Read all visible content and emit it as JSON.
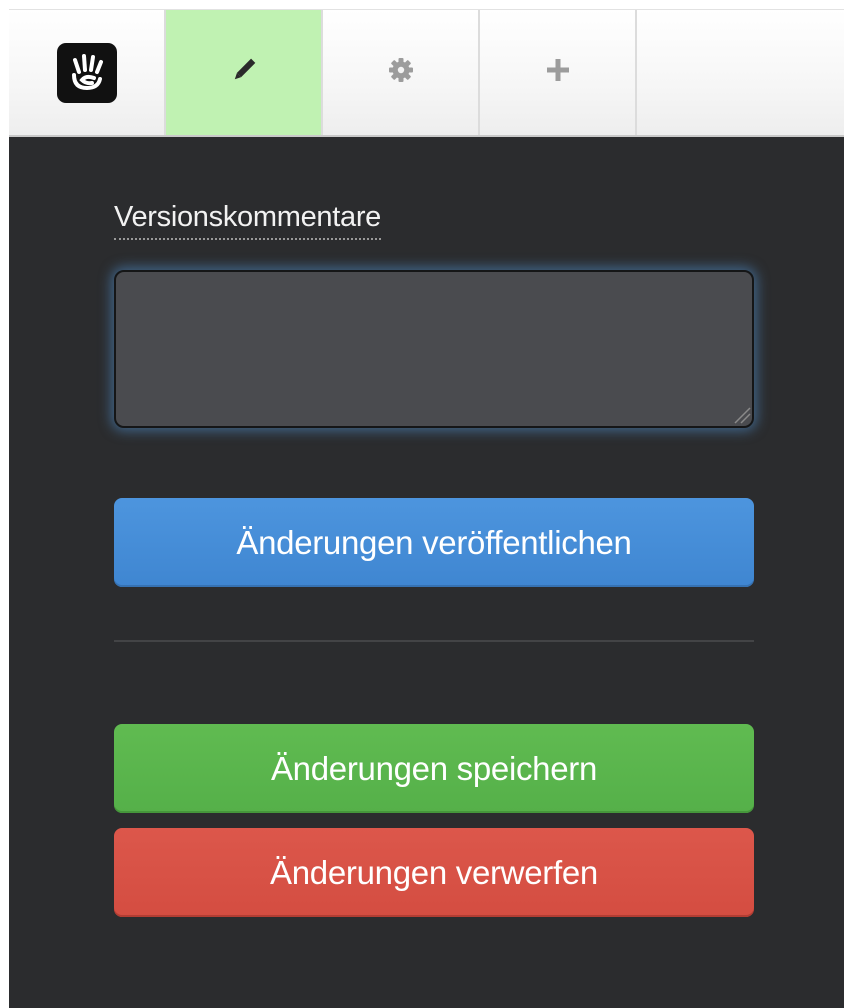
{
  "toolbar": {
    "items": [
      {
        "name": "logo",
        "icon": "hand-logo-icon",
        "active": false
      },
      {
        "name": "edit",
        "icon": "pencil-icon",
        "active": true
      },
      {
        "name": "settings",
        "icon": "gear-icon",
        "active": false
      },
      {
        "name": "add",
        "icon": "plus-icon",
        "active": false
      }
    ]
  },
  "panel": {
    "comment_label": "Versionskommentare",
    "comment_value": "",
    "publish_label": "Änderungen veröffentlichen",
    "save_label": "Änderungen speichern",
    "discard_label": "Änderungen verwerfen"
  },
  "colors": {
    "toolbar_active": "#c0f2b2",
    "panel_background": "#2b2c2e",
    "publish": "#4a90dc",
    "save": "#5cb74f",
    "discard": "#d9534a",
    "comment_glow": "#5091d2"
  }
}
